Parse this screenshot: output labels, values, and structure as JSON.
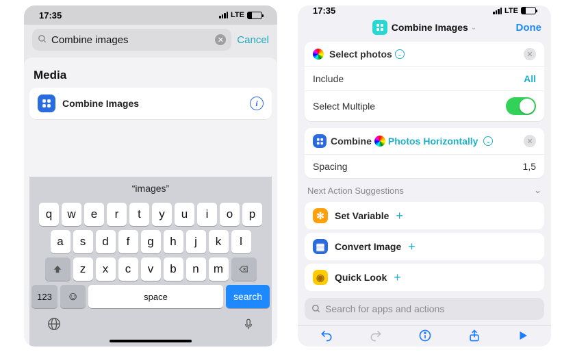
{
  "status": {
    "time": "17:35",
    "net": "LTE"
  },
  "left": {
    "search_value": "Combine images",
    "cancel": "Cancel",
    "section": "Media",
    "result": {
      "label": "Combine Images"
    },
    "suggestion": "“images”",
    "keys_r1": [
      "q",
      "w",
      "e",
      "r",
      "t",
      "y",
      "u",
      "i",
      "o",
      "p"
    ],
    "keys_r2": [
      "a",
      "s",
      "d",
      "f",
      "g",
      "h",
      "j",
      "k",
      "l"
    ],
    "keys_r3": [
      "z",
      "x",
      "c",
      "v",
      "b",
      "n",
      "m"
    ],
    "key_123": "123",
    "key_space": "space",
    "key_search": "search"
  },
  "right": {
    "title": "Combine Images",
    "done": "Done",
    "action1": {
      "head": "Select photos",
      "include_label": "Include",
      "include_value": "All",
      "multi_label": "Select Multiple"
    },
    "action2": {
      "p1": "Combine",
      "p2": "Photos",
      "p3": "Horizontally",
      "spacing_label": "Spacing",
      "spacing_value": "1,5"
    },
    "suggest_header": "Next Action Suggestions",
    "suggestions": [
      {
        "label": "Set Variable"
      },
      {
        "label": "Convert Image"
      },
      {
        "label": "Quick Look"
      }
    ],
    "search_placeholder": "Search for apps and actions"
  }
}
